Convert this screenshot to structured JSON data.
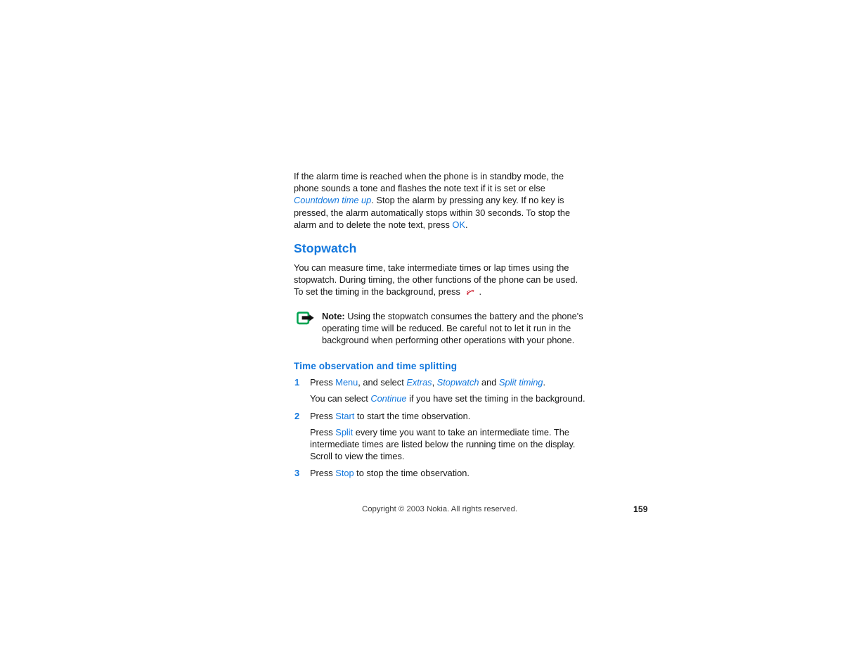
{
  "document": {
    "page_number": "159",
    "copyright": "Copyright © 2003 Nokia. All rights reserved.",
    "accent_color": "#1277dd",
    "text_color": "#161616",
    "background_color": "#ffffff"
  },
  "intro_paragraph": {
    "part1": "If the alarm time is reached when the phone is in standby mode, the phone sounds a tone and flashes the note text if it is set or else ",
    "term_countdown": "Countdown time up",
    "part2": ". Stop the alarm by pressing any key. If no key is pressed, the alarm automatically stops within 30 seconds. To stop the alarm and to delete the note text, press ",
    "term_ok": "OK",
    "part3": "."
  },
  "section": {
    "title": "Stopwatch",
    "paragraph_part1": "You can measure time, take intermediate times or lap times using the stopwatch. During timing, the other functions of the phone can be used. To set the timing in the background, press ",
    "phone_icon_name": "end-call-key-icon",
    "paragraph_part2": "."
  },
  "note": {
    "icon_name": "note-arrow-icon",
    "label": "Note:",
    "text": " Using the stopwatch consumes the battery and the phone's operating time will be reduced. Be careful not to let it run in the background when performing other operations with your phone."
  },
  "subsection": {
    "title": "Time observation and time splitting",
    "steps": [
      {
        "number": "1",
        "prefix": "Press ",
        "key": "Menu",
        "mid1": ", and select ",
        "menu1": "Extras",
        "mid2": ", ",
        "menu2": "Stopwatch",
        "mid3": " and ",
        "menu3": "Split timing",
        "suffix": ".",
        "sub_prefix": "You can select ",
        "sub_menu": "Continue",
        "sub_suffix": " if you have set the timing in the background."
      },
      {
        "number": "2",
        "prefix": "Press ",
        "key": "Start",
        "suffix": " to start the time observation.",
        "sub_prefix": "Press ",
        "sub_key": "Split",
        "sub_suffix": " every time you want to take an intermediate time. The intermediate times are listed below the running time on the display. Scroll to view the times."
      },
      {
        "number": "3",
        "prefix": "Press ",
        "key": "Stop",
        "suffix": " to stop the time observation."
      }
    ]
  }
}
